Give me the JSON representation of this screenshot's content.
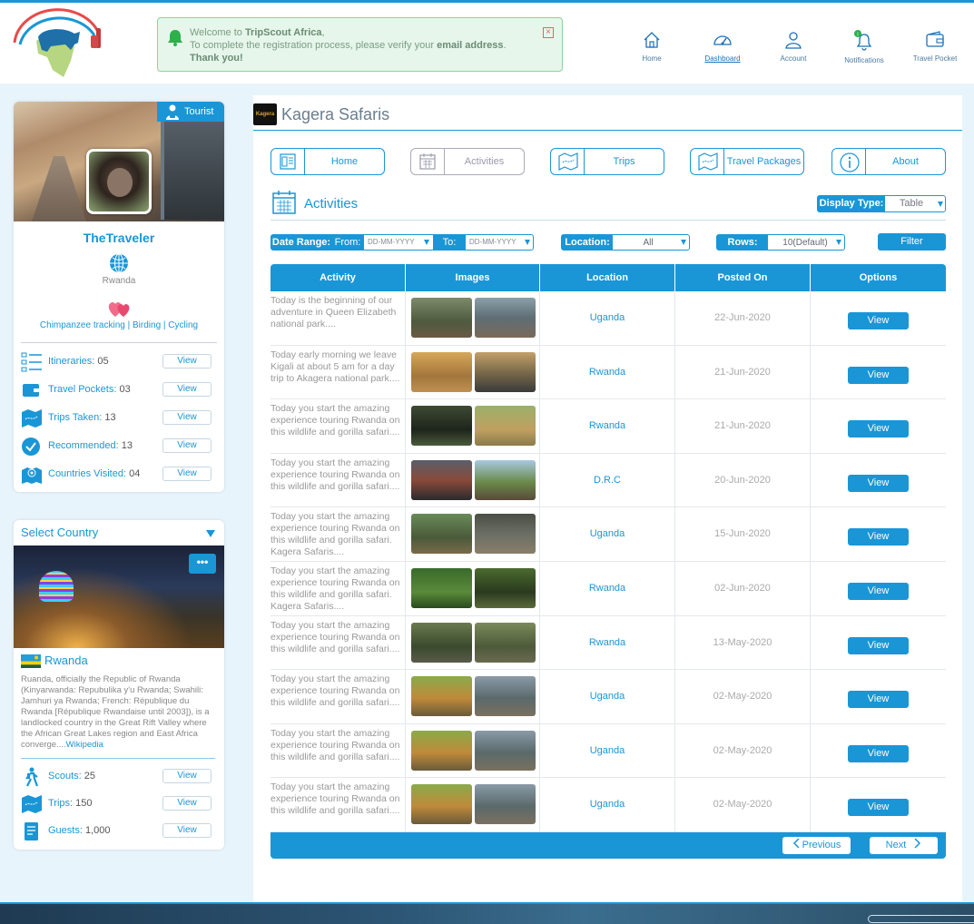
{
  "header": {
    "notice": {
      "line1_prefix": "Welcome to ",
      "line1_bold": "TripScout Africa",
      "line1_suffix": ",",
      "line2_prefix": "To complete the registration process, please verify your ",
      "line2_bold": "email address",
      "line2_suffix": ".",
      "line3": "Thank you!",
      "close": "×"
    },
    "nav": [
      {
        "label": "Home",
        "icon": "home-icon"
      },
      {
        "label": "Dashboard",
        "icon": "dashboard-icon",
        "active": true
      },
      {
        "label": "Account",
        "icon": "account-icon"
      },
      {
        "label": "Notifications",
        "icon": "bell-icon"
      },
      {
        "label": "Travel Pocket",
        "icon": "wallet-icon"
      }
    ]
  },
  "profile": {
    "badge": "Tourist",
    "name": "TheTraveler",
    "country": "Rwanda",
    "interests": "Chimpanzee tracking | Birding | Cycling",
    "stats": [
      {
        "label": "Itineraries:",
        "value": " 05",
        "button": "View",
        "icon": "itinerary-icon"
      },
      {
        "label": "Travel Pockets:",
        "value": " 03",
        "button": "View",
        "icon": "wallet-icon"
      },
      {
        "label": "Trips Taken:",
        "value": " 13",
        "button": "View",
        "icon": "map-icon"
      },
      {
        "label": "Recommended:",
        "value": " 13",
        "button": "View",
        "icon": "check-icon"
      },
      {
        "label": "Countries Visited:",
        "value": " 04",
        "button": "View",
        "icon": "location-icon"
      }
    ]
  },
  "country_card": {
    "select_label": "Select Country",
    "more": "•••",
    "name": "Rwanda",
    "description": "Ruanda, officially the Republic of Rwanda (Kinyarwanda: Repubulika y'u Rwanda; Swahili: Jamhuri ya Rwanda; French: République du Rwanda [République Rwandaise until 2003]), is a landlocked country in the Great Rift Valley where the African Great Lakes region and East Africa converge....",
    "link": "Wikipedia",
    "stats": [
      {
        "label": "Scouts:",
        "value": " 25",
        "button": "View",
        "icon": "hiker-icon"
      },
      {
        "label": "Trips:",
        "value": " 150",
        "button": "View",
        "icon": "map-icon"
      },
      {
        "label": "Guests:",
        "value": " 1,000",
        "button": "View",
        "icon": "guestbook-icon"
      }
    ]
  },
  "company": {
    "logo_text": "Kagera",
    "name": "Kagera Safaris",
    "tabs": [
      {
        "label": "Home",
        "icon": "home-page-icon"
      },
      {
        "label": "Activities",
        "icon": "calendar-icon",
        "disabled": true
      },
      {
        "label": "Trips",
        "icon": "map-icon"
      },
      {
        "label": "Travel Packages",
        "icon": "package-map-icon"
      },
      {
        "label": "About",
        "icon": "info-icon"
      }
    ]
  },
  "activities": {
    "title": "Activities",
    "display_type_label": "Display Type:",
    "display_type_value": "Table",
    "date_range_label": "Date Range:",
    "from_label": "From:",
    "from_placeholder": "DD-MM-YYYY",
    "to_label": "To:",
    "to_placeholder": "DD-MM-YYYY",
    "location_label": "Location:",
    "location_value": "All",
    "rows_label": "Rows:",
    "rows_value": "10(Default)",
    "filter_button": "Filter",
    "columns": [
      "Activity",
      "Images",
      "Location",
      "Posted On",
      "Options"
    ],
    "rows": [
      {
        "desc": "Today is the beginning of our adventure in Queen Elizabeth national park....",
        "location": "Uganda",
        "date": "22-Jun-2020",
        "option": "View"
      },
      {
        "desc": "Today early morning we leave Kigali at about 5 am for a day trip to Akagera national park....",
        "location": "Rwanda",
        "date": "21-Jun-2020",
        "option": "View"
      },
      {
        "desc": "Today you start the amazing experience touring Rwanda on this wildlife and gorilla safari....",
        "location": "Rwanda",
        "date": "21-Jun-2020",
        "option": "View"
      },
      {
        "desc": "Today you start the amazing experience touring Rwanda on this wildlife and gorilla safari....",
        "location": "D.R.C",
        "date": "20-Jun-2020",
        "option": "View"
      },
      {
        "desc": "Today you start the amazing experience touring Rwanda on this wildlife and gorilla safari. Kagera Safaris....",
        "location": "Uganda",
        "date": "15-Jun-2020",
        "option": "View"
      },
      {
        "desc": "Today you start the amazing experience touring Rwanda on this wildlife and gorilla safari. Kagera Safaris....",
        "location": "Rwanda",
        "date": "02-Jun-2020",
        "option": "View"
      },
      {
        "desc": "Today you start the amazing experience touring Rwanda on this wildlife and gorilla safari....",
        "location": "Rwanda",
        "date": "13-May-2020",
        "option": "View"
      },
      {
        "desc": "Today you start the amazing experience touring Rwanda on this wildlife and gorilla safari....",
        "location": "Uganda",
        "date": "02-May-2020",
        "option": "View"
      },
      {
        "desc": "Today you start the amazing experience touring Rwanda on this wildlife and gorilla safari....",
        "location": "Uganda",
        "date": "02-May-2020",
        "option": "View"
      },
      {
        "desc": "Today you start the amazing experience touring Rwanda on this wildlife and gorilla safari....",
        "location": "Uganda",
        "date": "02-May-2020",
        "option": "View"
      }
    ],
    "prev_label": "Previous",
    "next_label": "Next"
  },
  "colors": {
    "accent": "#1a96d6",
    "notice_bg": "#e6f6ea"
  }
}
